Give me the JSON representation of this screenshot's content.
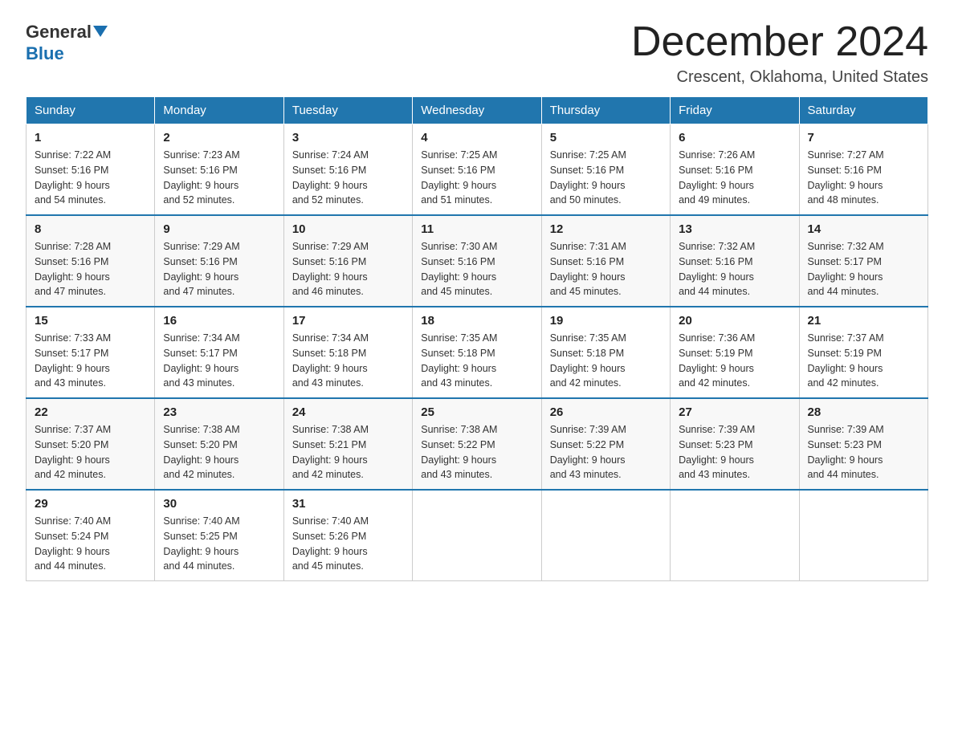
{
  "header": {
    "logo_general": "General",
    "logo_blue": "Blue",
    "month_title": "December 2024",
    "location": "Crescent, Oklahoma, United States"
  },
  "days_of_week": [
    "Sunday",
    "Monday",
    "Tuesday",
    "Wednesday",
    "Thursday",
    "Friday",
    "Saturday"
  ],
  "weeks": [
    [
      {
        "day": "1",
        "sunrise": "7:22 AM",
        "sunset": "5:16 PM",
        "daylight": "9 hours and 54 minutes."
      },
      {
        "day": "2",
        "sunrise": "7:23 AM",
        "sunset": "5:16 PM",
        "daylight": "9 hours and 52 minutes."
      },
      {
        "day": "3",
        "sunrise": "7:24 AM",
        "sunset": "5:16 PM",
        "daylight": "9 hours and 52 minutes."
      },
      {
        "day": "4",
        "sunrise": "7:25 AM",
        "sunset": "5:16 PM",
        "daylight": "9 hours and 51 minutes."
      },
      {
        "day": "5",
        "sunrise": "7:25 AM",
        "sunset": "5:16 PM",
        "daylight": "9 hours and 50 minutes."
      },
      {
        "day": "6",
        "sunrise": "7:26 AM",
        "sunset": "5:16 PM",
        "daylight": "9 hours and 49 minutes."
      },
      {
        "day": "7",
        "sunrise": "7:27 AM",
        "sunset": "5:16 PM",
        "daylight": "9 hours and 48 minutes."
      }
    ],
    [
      {
        "day": "8",
        "sunrise": "7:28 AM",
        "sunset": "5:16 PM",
        "daylight": "9 hours and 47 minutes."
      },
      {
        "day": "9",
        "sunrise": "7:29 AM",
        "sunset": "5:16 PM",
        "daylight": "9 hours and 47 minutes."
      },
      {
        "day": "10",
        "sunrise": "7:29 AM",
        "sunset": "5:16 PM",
        "daylight": "9 hours and 46 minutes."
      },
      {
        "day": "11",
        "sunrise": "7:30 AM",
        "sunset": "5:16 PM",
        "daylight": "9 hours and 45 minutes."
      },
      {
        "day": "12",
        "sunrise": "7:31 AM",
        "sunset": "5:16 PM",
        "daylight": "9 hours and 45 minutes."
      },
      {
        "day": "13",
        "sunrise": "7:32 AM",
        "sunset": "5:16 PM",
        "daylight": "9 hours and 44 minutes."
      },
      {
        "day": "14",
        "sunrise": "7:32 AM",
        "sunset": "5:17 PM",
        "daylight": "9 hours and 44 minutes."
      }
    ],
    [
      {
        "day": "15",
        "sunrise": "7:33 AM",
        "sunset": "5:17 PM",
        "daylight": "9 hours and 43 minutes."
      },
      {
        "day": "16",
        "sunrise": "7:34 AM",
        "sunset": "5:17 PM",
        "daylight": "9 hours and 43 minutes."
      },
      {
        "day": "17",
        "sunrise": "7:34 AM",
        "sunset": "5:18 PM",
        "daylight": "9 hours and 43 minutes."
      },
      {
        "day": "18",
        "sunrise": "7:35 AM",
        "sunset": "5:18 PM",
        "daylight": "9 hours and 43 minutes."
      },
      {
        "day": "19",
        "sunrise": "7:35 AM",
        "sunset": "5:18 PM",
        "daylight": "9 hours and 42 minutes."
      },
      {
        "day": "20",
        "sunrise": "7:36 AM",
        "sunset": "5:19 PM",
        "daylight": "9 hours and 42 minutes."
      },
      {
        "day": "21",
        "sunrise": "7:37 AM",
        "sunset": "5:19 PM",
        "daylight": "9 hours and 42 minutes."
      }
    ],
    [
      {
        "day": "22",
        "sunrise": "7:37 AM",
        "sunset": "5:20 PM",
        "daylight": "9 hours and 42 minutes."
      },
      {
        "day": "23",
        "sunrise": "7:38 AM",
        "sunset": "5:20 PM",
        "daylight": "9 hours and 42 minutes."
      },
      {
        "day": "24",
        "sunrise": "7:38 AM",
        "sunset": "5:21 PM",
        "daylight": "9 hours and 42 minutes."
      },
      {
        "day": "25",
        "sunrise": "7:38 AM",
        "sunset": "5:22 PM",
        "daylight": "9 hours and 43 minutes."
      },
      {
        "day": "26",
        "sunrise": "7:39 AM",
        "sunset": "5:22 PM",
        "daylight": "9 hours and 43 minutes."
      },
      {
        "day": "27",
        "sunrise": "7:39 AM",
        "sunset": "5:23 PM",
        "daylight": "9 hours and 43 minutes."
      },
      {
        "day": "28",
        "sunrise": "7:39 AM",
        "sunset": "5:23 PM",
        "daylight": "9 hours and 44 minutes."
      }
    ],
    [
      {
        "day": "29",
        "sunrise": "7:40 AM",
        "sunset": "5:24 PM",
        "daylight": "9 hours and 44 minutes."
      },
      {
        "day": "30",
        "sunrise": "7:40 AM",
        "sunset": "5:25 PM",
        "daylight": "9 hours and 44 minutes."
      },
      {
        "day": "31",
        "sunrise": "7:40 AM",
        "sunset": "5:26 PM",
        "daylight": "9 hours and 45 minutes."
      },
      null,
      null,
      null,
      null
    ]
  ],
  "labels": {
    "sunrise": "Sunrise:",
    "sunset": "Sunset:",
    "daylight": "Daylight:"
  }
}
